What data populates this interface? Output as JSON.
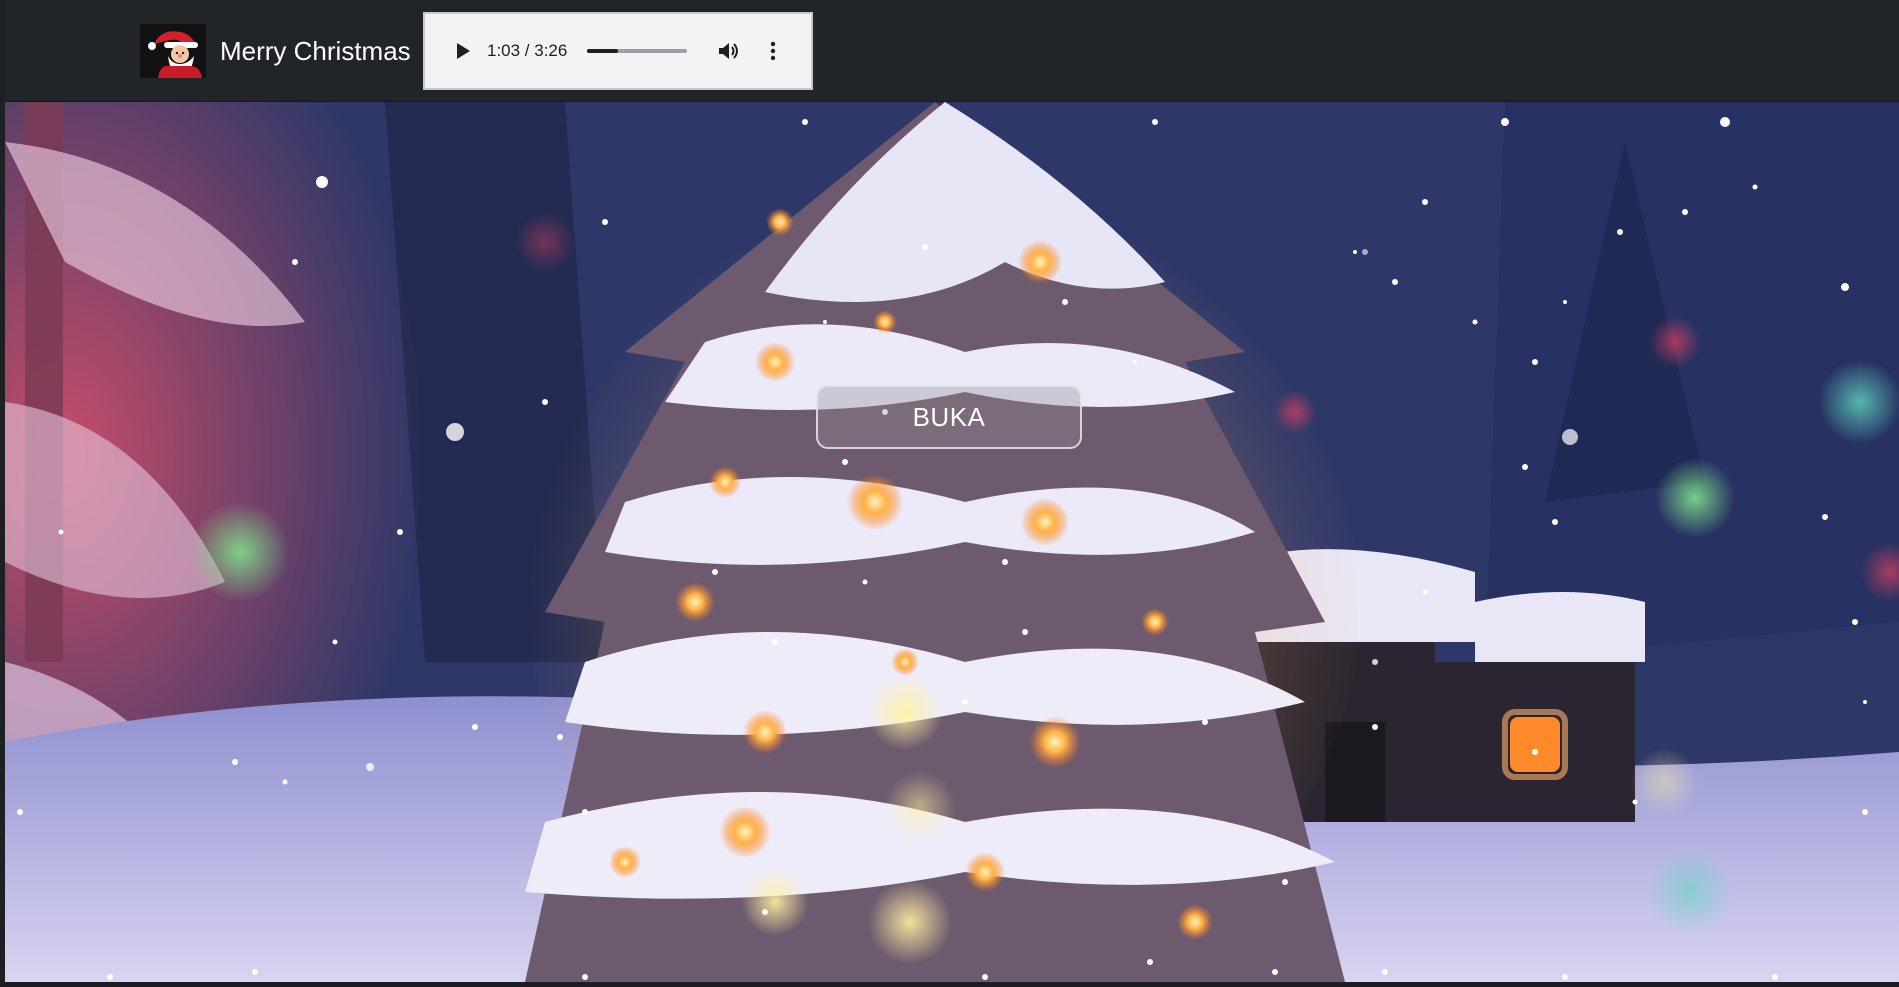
{
  "navbar": {
    "brand_text": "Merry Christmas",
    "logo_icon": "santa-claus-icon"
  },
  "audio": {
    "time_display": "1:03 / 3:26",
    "current": "1:03",
    "duration": "3:26",
    "progress_fraction": 0.306,
    "play_icon": "play-icon",
    "volume_icon": "volume-icon",
    "menu_icon": "more-vert-icon"
  },
  "hero": {
    "button_label": "BUKA",
    "scene": "snowy-christmas-tree-night"
  },
  "colors": {
    "navbar_bg": "#212529",
    "player_bg": "#f1f3f4",
    "tree_light": "#ffb347"
  }
}
